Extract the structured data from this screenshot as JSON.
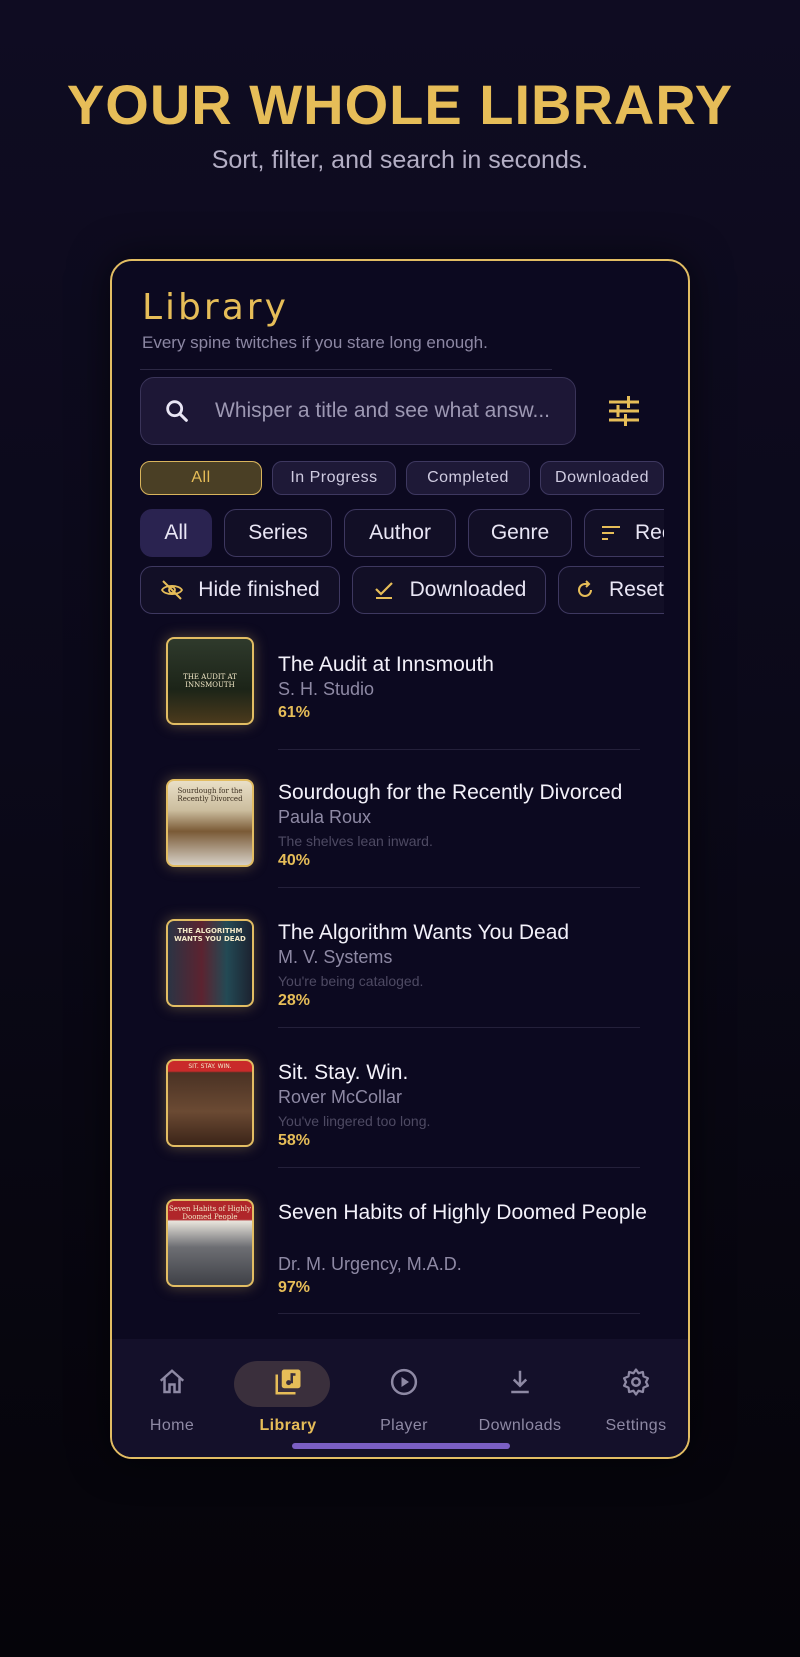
{
  "promo": {
    "headline": "YOUR WHOLE LIBRARY",
    "subhead": "Sort, filter, and search in seconds."
  },
  "library": {
    "title": "Library",
    "subtitle": "Every spine twitches if you stare long enough.",
    "search_placeholder": "Whisper a title and see what answ..."
  },
  "status_chips": [
    {
      "label": "All",
      "active": true
    },
    {
      "label": "In Progress",
      "active": false
    },
    {
      "label": "Completed",
      "active": false
    },
    {
      "label": "Downloaded",
      "active": false
    }
  ],
  "group_tabs": [
    {
      "label": "All",
      "active": true
    },
    {
      "label": "Series",
      "active": false
    },
    {
      "label": "Author",
      "active": false
    },
    {
      "label": "Genre",
      "active": false
    },
    {
      "label": "Recent",
      "active": false
    }
  ],
  "filters": [
    {
      "label": "Hide finished",
      "icon": "eye-off-icon"
    },
    {
      "label": "Downloaded",
      "icon": "checkmark-icon"
    },
    {
      "label": "Reset",
      "icon": "reset-icon"
    }
  ],
  "books": [
    {
      "title": "The Audit at Innsmouth",
      "author": "S. H. Studio",
      "note": "",
      "progress": "61%",
      "cover_text": "THE AUDIT AT INNSMOUTH"
    },
    {
      "title": "Sourdough for the Recently Divorced",
      "author": "Paula Roux",
      "note": "The shelves lean inward.",
      "progress": "40%",
      "cover_text": "Sourdough for the Recently Divorced"
    },
    {
      "title": "The Algorithm Wants You Dead",
      "author": "M. V. Systems",
      "note": "You're being cataloged.",
      "progress": "28%",
      "cover_text": "THE ALGORITHM WANTS YOU DEAD"
    },
    {
      "title": "Sit. Stay. Win.",
      "author": "Rover McCollar",
      "note": "You've lingered too long.",
      "progress": "58%",
      "cover_text": "SIT. STAY. WIN."
    },
    {
      "title": "Seven Habits of Highly Doomed People",
      "author": "Dr. M. Urgency, M.A.D.",
      "note": "",
      "progress": "97%",
      "cover_text": "Seven Habits of Highly Doomed People"
    }
  ],
  "nav": [
    {
      "label": "Home",
      "icon": "home-icon",
      "active": false
    },
    {
      "label": "Library",
      "icon": "library-icon",
      "active": true
    },
    {
      "label": "Player",
      "icon": "play-icon",
      "active": false
    },
    {
      "label": "Downloads",
      "icon": "download-icon",
      "active": false
    },
    {
      "label": "Settings",
      "icon": "gear-icon",
      "active": false
    }
  ],
  "colors": {
    "accent": "#e6bd58",
    "background": "#0c0920",
    "nav_indicator": "#7b5fc4"
  }
}
